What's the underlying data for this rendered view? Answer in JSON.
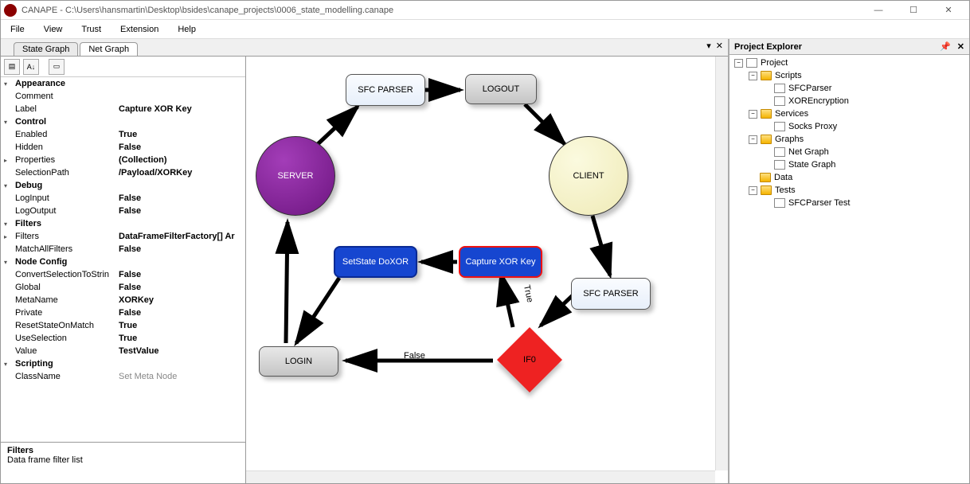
{
  "window": {
    "title": "CANAPE - C:\\Users\\hansmartin\\Desktop\\bsides\\canape_projects\\0006_state_modelling.canape"
  },
  "menu": [
    "File",
    "View",
    "Trust",
    "Extension",
    "Help"
  ],
  "tabs": {
    "state": "State Graph",
    "net": "Net Graph"
  },
  "properties": {
    "appearance": {
      "header": "Appearance",
      "comment_k": "Comment",
      "comment_v": "",
      "label_k": "Label",
      "label_v": "Capture XOR Key"
    },
    "control": {
      "header": "Control",
      "enabled_k": "Enabled",
      "enabled_v": "True",
      "hidden_k": "Hidden",
      "hidden_v": "False",
      "properties_k": "Properties",
      "properties_v": "(Collection)",
      "selpath_k": "SelectionPath",
      "selpath_v": "/Payload/XORKey"
    },
    "debug": {
      "header": "Debug",
      "logi_k": "LogInput",
      "logi_v": "False",
      "logo_k": "LogOutput",
      "logo_v": "False"
    },
    "filters": {
      "header": "Filters",
      "filters_k": "Filters",
      "filters_v": "DataFrameFilterFactory[] Ar",
      "match_k": "MatchAllFilters",
      "match_v": "False"
    },
    "nodecfg": {
      "header": "Node Config",
      "conv_k": "ConvertSelectionToStrin",
      "conv_v": "False",
      "global_k": "Global",
      "global_v": "False",
      "meta_k": "MetaName",
      "meta_v": "XORKey",
      "private_k": "Private",
      "private_v": "False",
      "reset_k": "ResetStateOnMatch",
      "reset_v": "True",
      "usesel_k": "UseSelection",
      "usesel_v": "True",
      "value_k": "Value",
      "value_v": "TestValue"
    },
    "scripting": {
      "header": "Scripting",
      "class_k": "ClassName",
      "class_v": "Set Meta Node"
    },
    "footer": {
      "title": "Filters",
      "desc": "Data frame filter list"
    }
  },
  "graph": {
    "server": "SERVER",
    "client": "CLIENT",
    "sfc": "SFC PARSER",
    "logout": "LOGOUT",
    "setstate": "SetState DoXOR",
    "capture": "Capture XOR Key",
    "login": "LOGIN",
    "if0": "IF0",
    "true": "True",
    "false": "False"
  },
  "explorer": {
    "title": "Project Explorer",
    "root": "Project",
    "scripts": "Scripts",
    "sfcparser": "SFCParser",
    "xorenc": "XOREncryption",
    "services": "Services",
    "socks": "Socks Proxy",
    "graphs": "Graphs",
    "netgraph": "Net Graph",
    "stategraph": "State Graph",
    "data": "Data",
    "tests": "Tests",
    "sfctest": "SFCParser Test"
  }
}
